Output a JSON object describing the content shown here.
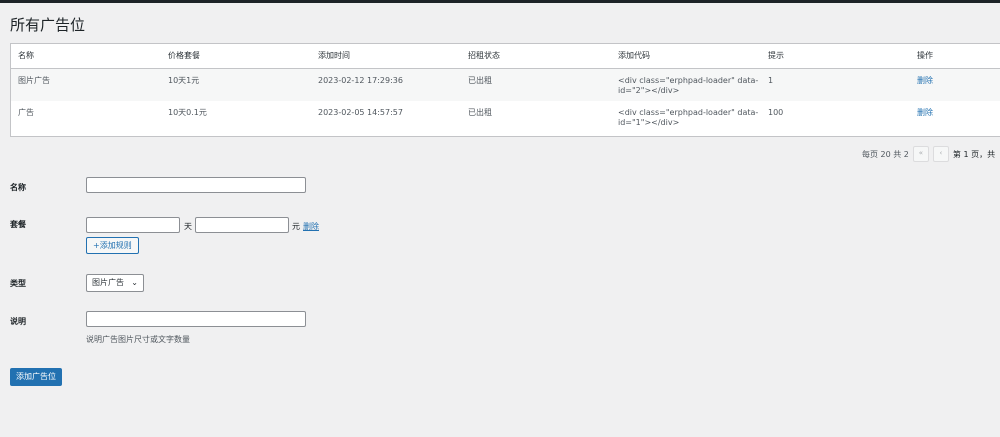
{
  "page_title": "所有广告位",
  "table": {
    "headers": [
      "名称",
      "价格套餐",
      "添加时间",
      "招租状态",
      "添加代码",
      "提示",
      "操作"
    ],
    "rows": [
      {
        "name": "图片广告",
        "price": "10天1元",
        "time": "2023-02-12 17:29:36",
        "status": "已出租",
        "code_line1": "<div class=\"erphpad-loader\" data-",
        "code_line2": "id=\"2\"></div>",
        "tip": "1",
        "action": "删除"
      },
      {
        "name": "广告",
        "price": "10天0.1元",
        "time": "2023-02-05 14:57:57",
        "status": "已出租",
        "code_line1": "<div class=\"erphpad-loader\" data-",
        "code_line2": "id=\"1\"></div>",
        "tip": "100",
        "action": "删除"
      }
    ]
  },
  "pagination": {
    "summary": "每页 20 共 2",
    "first": "«",
    "prev": "‹",
    "page_text": "第 1 页，共"
  },
  "form": {
    "name_label": "名称",
    "package_label": "套餐",
    "day_unit": "天",
    "yuan_unit": "元",
    "delete_link": "删除",
    "add_rule_button": "+添加规则",
    "type_label": "类型",
    "type_selected": "图片广告",
    "desc_label": "说明",
    "desc_help": "说明广告图片尺寸或文字数量",
    "submit_button": "添加广告位"
  },
  "colors": {
    "primary": "#2271b1",
    "background": "#f0f0f1"
  }
}
